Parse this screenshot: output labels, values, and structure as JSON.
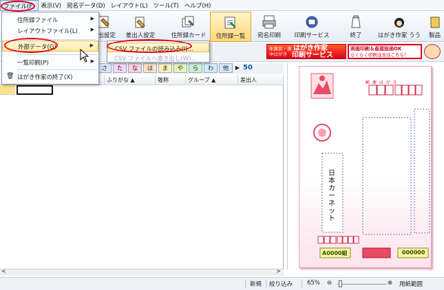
{
  "menubar": {
    "items": [
      "ファイル(F)",
      "表示(V)",
      "宛名データ(D)",
      "レイアウト(L)",
      "ツール(T)",
      "ヘルプ(H)"
    ]
  },
  "toolbar": {
    "buttons": [
      "差出設定",
      "差出人設定",
      "住所録カード",
      "住所録一覧",
      "宛名印刷",
      "印刷サービス",
      "終了",
      "はがき作家 うう",
      "製品"
    ]
  },
  "banners": {
    "left_small": "年賀状・喪中はがき",
    "left_big": "はがき作家",
    "left_big2": "印刷サービス",
    "right_line1": "両面印刷＆直接投函OK",
    "right_line2": "らくらく印刷注文はこちら！"
  },
  "kana_tabs": [
    "さ",
    "た",
    "な",
    "は",
    "ま",
    "や",
    "ら",
    "わ",
    "他"
  ],
  "kana_extra": "50",
  "grid": {
    "headers": [
      "ふりがな ▲",
      "敬称",
      "グループ ▲",
      "差出人"
    ]
  },
  "file_menu": {
    "items": [
      "住所録ファイル",
      "レイアウトファイル(L)",
      "外部データ(G)",
      "一覧印刷(P)",
      "はがき作家の終了(X)"
    ]
  },
  "submenu": {
    "items": [
      "CSV ファイルの読み込み(I)...",
      "CSV ファイルへ書き出し(W)..."
    ]
  },
  "card": {
    "postal_label": "郵 便 は が き",
    "recipient": "日本カーネット",
    "left_bottom": "A0000組",
    "right_bottom": "000000"
  },
  "status": {
    "new": "新規",
    "filter": "絞り込み",
    "zoom": "65%",
    "paper": "用紙範囲"
  },
  "colors": {
    "highlight_ring": "#e3001b",
    "menu_highlight": "#ffe9a6",
    "card_pink": "#fde2ec"
  }
}
